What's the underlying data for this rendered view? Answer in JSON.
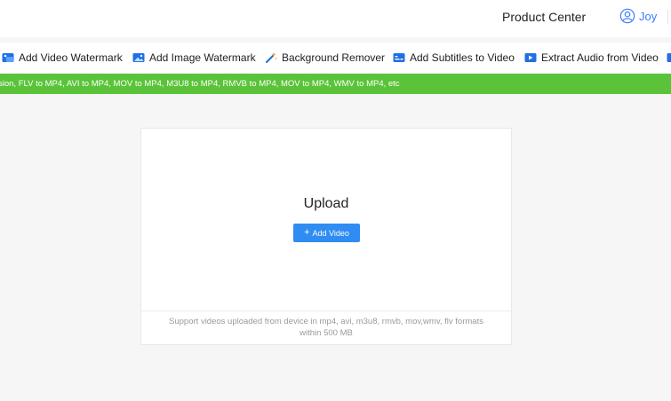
{
  "header": {
    "product_center": "Product Center",
    "user_name": "Joy"
  },
  "toolbar": {
    "items": [
      {
        "label": "Add Video Watermark",
        "icon": "video-watermark-icon"
      },
      {
        "label": "Add Image Watermark",
        "icon": "image-watermark-icon"
      },
      {
        "label": "Background Remover",
        "icon": "magic-wand-icon"
      },
      {
        "label": "Add Subtitles to Video",
        "icon": "subtitles-icon"
      },
      {
        "label": "Extract Audio from Video",
        "icon": "extract-audio-icon"
      }
    ]
  },
  "banner": {
    "text": "sion, FLV to MP4, AVI to MP4, MOV to MP4, M3U8 to MP4, RMVB to MP4, MOV to MP4, WMV to MP4, etc"
  },
  "upload": {
    "title": "Upload",
    "add_button": "Add Video",
    "support_line1": "Support videos uploaded from device in mp4, avi, m3u8, rmvb, mov,wmv, flv formats",
    "support_line2": "within 500 MB"
  },
  "colors": {
    "accent": "#2f8cf2",
    "banner": "#5bc33a",
    "user_link": "#3a7bff"
  }
}
